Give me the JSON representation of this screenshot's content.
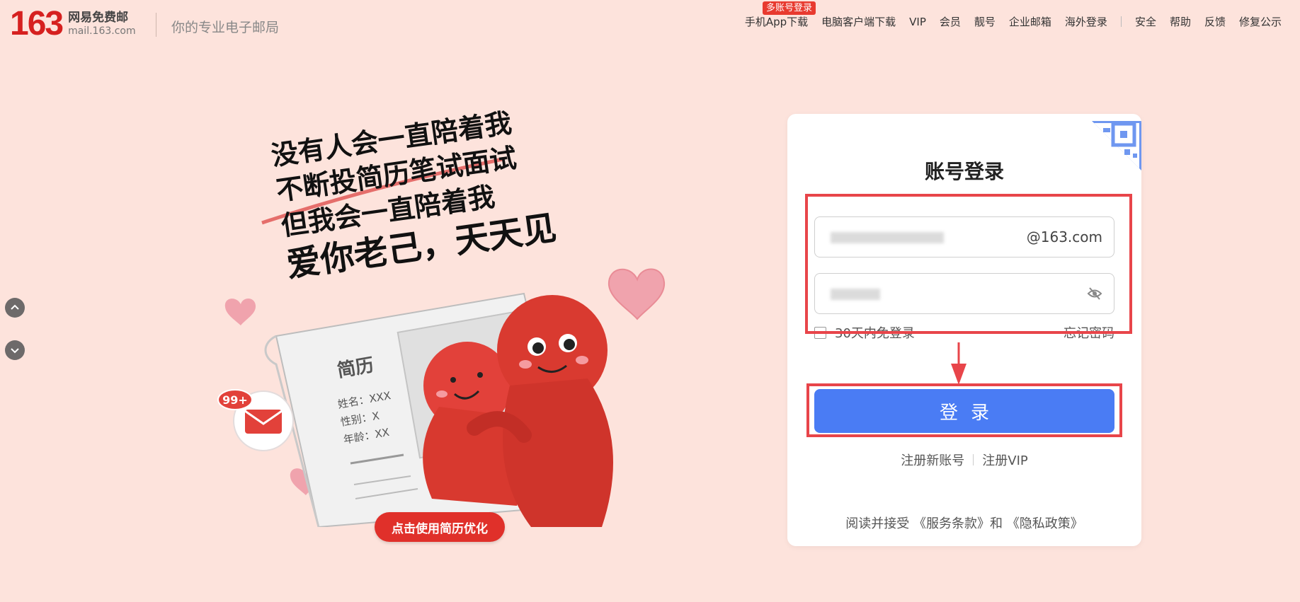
{
  "header": {
    "logo_number": "163",
    "logo_cn": "网易免费邮",
    "logo_en": "mail.163.com",
    "slogan": "你的专业电子邮局",
    "badge": "多账号登录",
    "nav": [
      "手机App下载",
      "电脑客户端下载",
      "VIP",
      "会员",
      "靓号",
      "企业邮箱",
      "海外登录"
    ],
    "nav_right": [
      "安全",
      "帮助",
      "反馈",
      "修复公示"
    ]
  },
  "promo": {
    "lines": [
      "没有人会一直陪着我",
      "不断投简历笔试面试",
      "但我会一直陪着我",
      "爱你老己，天天见"
    ],
    "resume_title": "简历",
    "resume_fields": [
      "姓名：XXX",
      "性别：X",
      "年龄：XX"
    ],
    "mail_badge": "99+",
    "button": "点击使用简历优化"
  },
  "login": {
    "title": "账号登录",
    "username_value": "",
    "domain_suffix": "@163.com",
    "password_value": "",
    "remember_label": "30天内免登录",
    "forgot_label": "忘记密码",
    "submit_label": "登录",
    "register_label": "注册新账号",
    "register_vip_label": "注册VIP",
    "terms": "阅读并接受 《服务条款》和 《隐私政策》"
  },
  "colors": {
    "background": "#fde3dc",
    "brand_red": "#d6201f",
    "login_blue": "#4a7cf4",
    "annotation_red": "#e8454a",
    "promo_button": "#e0302a"
  },
  "icons": {
    "qr": "qr-code-icon",
    "eye": "eye-hidden-icon",
    "up": "chevron-up-icon",
    "down": "chevron-down-icon"
  }
}
